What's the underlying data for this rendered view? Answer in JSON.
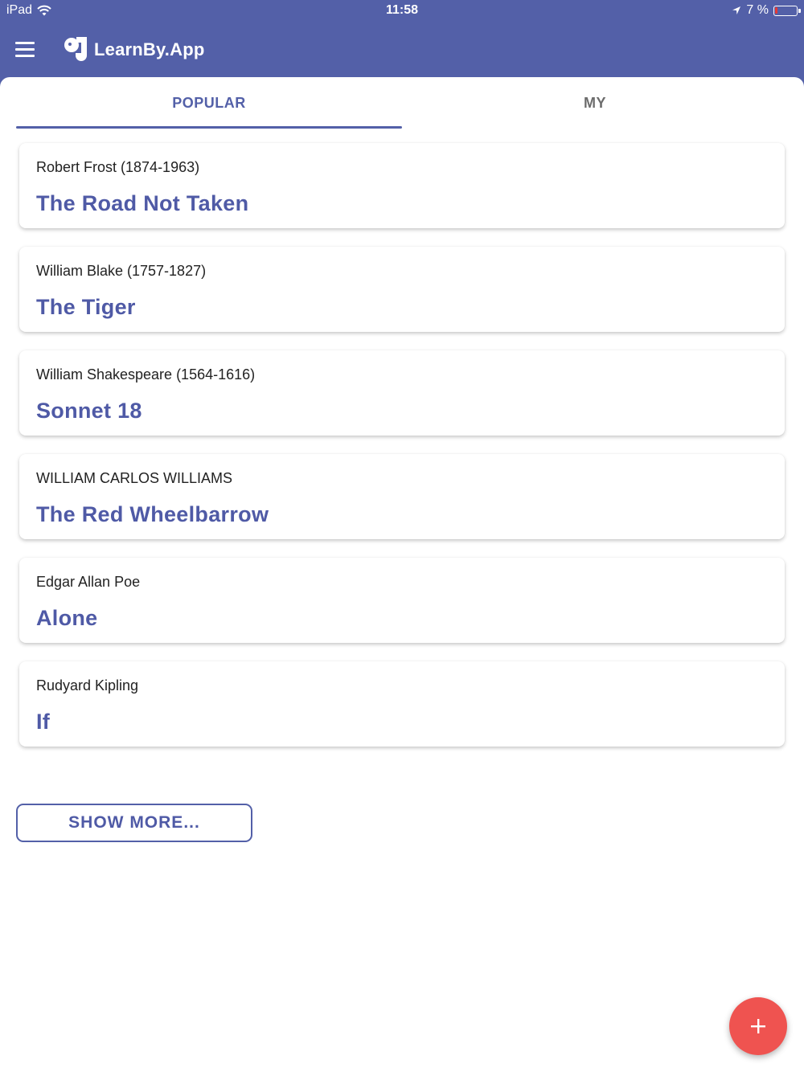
{
  "status_bar": {
    "device": "iPad",
    "time": "11:58",
    "battery": "7 %"
  },
  "app": {
    "title": "LearnBy.App"
  },
  "tabs": [
    {
      "label": "POPULAR",
      "active": true
    },
    {
      "label": "MY",
      "active": false
    }
  ],
  "poems": [
    {
      "author": "Robert Frost (1874-1963)",
      "title": "The Road Not Taken"
    },
    {
      "author": "William Blake (1757-1827)",
      "title": "The Tiger"
    },
    {
      "author": "William Shakespeare (1564-1616)",
      "title": "Sonnet 18"
    },
    {
      "author": "WILLIAM CARLOS WILLIAMS",
      "title": "The Red Wheelbarrow"
    },
    {
      "author": "Edgar Allan Poe",
      "title": "Alone"
    },
    {
      "author": "Rudyard Kipling",
      "title": "If"
    }
  ],
  "show_more": {
    "label": "SHOW MORE..."
  },
  "fab": {
    "icon": "plus-icon"
  },
  "colors": {
    "primary": "#5360a8",
    "accent": "#ef5350",
    "title_text": "#4f5aa6"
  }
}
